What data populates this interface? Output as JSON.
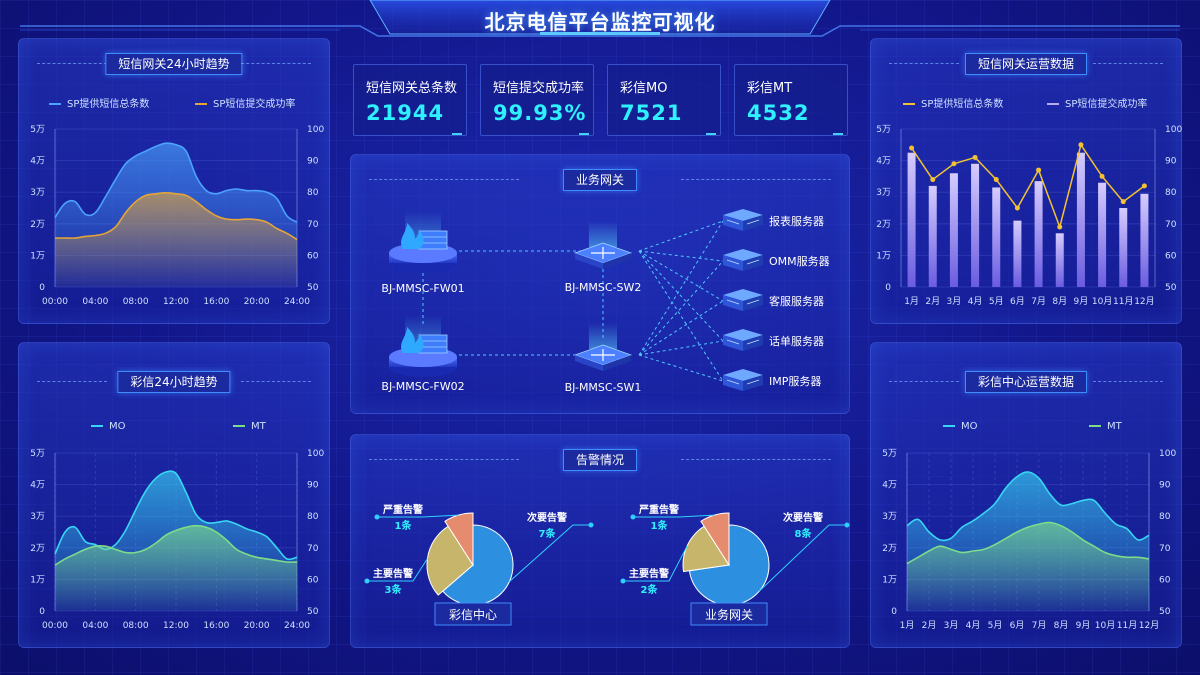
{
  "page": {
    "title": "北京电信平台监控可视化"
  },
  "colors": {
    "bg": "#10127a",
    "cyan": "#2ff0ff",
    "accent_blue": "#3f8cff",
    "sp_total": "#4ba3ff",
    "sp_rate": "#e3a53a",
    "mo": "#38d6f5",
    "mt": "#7ddc8a",
    "gold_line": "#f2c233",
    "bar_purple": "#b7a8f2",
    "pie_minor": "#2d8fe0",
    "pie_major": "#c6b56a",
    "pie_severe": "#e58b6e"
  },
  "kpis": [
    {
      "label": "短信网关总条数",
      "value": "21944"
    },
    {
      "label": "短信提交成功率",
      "value": "99.93%"
    },
    {
      "label": "彩信MO",
      "value": "7521"
    },
    {
      "label": "彩信MT",
      "value": "4532"
    }
  ],
  "panels": {
    "sms_trend": {
      "title": "短信网关24小时趋势",
      "legend": [
        "SP提供短信总条数",
        "SP短信提交成功率"
      ]
    },
    "mms_trend": {
      "title": "彩信24小时趋势",
      "legend": [
        "MO",
        "MT"
      ]
    },
    "sms_ops": {
      "title": "短信网关运营数据",
      "legend": [
        "SP提供短信总条数",
        "SP短信提交成功率"
      ]
    },
    "mms_ops": {
      "title": "彩信中心运营数据",
      "legend": [
        "MO",
        "MT"
      ]
    },
    "gateway": {
      "title": "业务网关",
      "nodes": {
        "fw01": "BJ-MMSC-FW01",
        "fw02": "BJ-MMSC-FW02",
        "sw2": "BJ-MMSC-SW2",
        "sw1": "BJ-MMSC-SW1"
      },
      "servers": [
        "报表服务器",
        "OMM服务器",
        "客服服务器",
        "话单服务器",
        "IMP服务器"
      ],
      "icons": {
        "firewall": "firewall-icon",
        "switch": "switch-icon",
        "server": "server-icon"
      }
    },
    "alarms": {
      "title": "告警情况",
      "pies": [
        {
          "name": "彩信中心",
          "slices": [
            {
              "label": "次要告警",
              "count": "7条",
              "value": 7
            },
            {
              "label": "主要告警",
              "count": "3条",
              "value": 3
            },
            {
              "label": "严重告警",
              "count": "1条",
              "value": 1
            }
          ]
        },
        {
          "name": "业务网关",
          "slices": [
            {
              "label": "次要告警",
              "count": "8条",
              "value": 8
            },
            {
              "label": "主要告警",
              "count": "2条",
              "value": 2
            },
            {
              "label": "严重告警",
              "count": "1条",
              "value": 1
            }
          ]
        }
      ]
    }
  },
  "chart_data": [
    {
      "id": "sms_trend",
      "type": "area",
      "x": [
        "00:00",
        "04:00",
        "08:00",
        "12:00",
        "16:00",
        "20:00",
        "24:00"
      ],
      "y_left_ticks": [
        "0",
        "1万",
        "2万",
        "3万",
        "4万",
        "5万"
      ],
      "y_right_ticks": [
        "50",
        "60",
        "70",
        "80",
        "90",
        "100"
      ],
      "ylim_left": [
        0,
        50000
      ],
      "ylim_right": [
        50,
        100
      ],
      "series": [
        {
          "name": "SP提供短信总条数",
          "axis": "left",
          "x": [
            0,
            1,
            2,
            3,
            4,
            5,
            6,
            7,
            8,
            9,
            10,
            11,
            12,
            13,
            14,
            15,
            16,
            17,
            18,
            19,
            20,
            21,
            22,
            23,
            24
          ],
          "values": [
            22000,
            26500,
            27000,
            23000,
            23500,
            28500,
            34000,
            39000,
            41500,
            43000,
            44500,
            45500,
            45000,
            43000,
            35000,
            30500,
            29500,
            30500,
            31000,
            30500,
            30500,
            30000,
            28000,
            22500,
            20500
          ]
        },
        {
          "name": "SP短信提交成功率",
          "axis": "right",
          "x": [
            0,
            1,
            2,
            3,
            4,
            5,
            6,
            7,
            8,
            9,
            10,
            11,
            12,
            13,
            14,
            15,
            16,
            17,
            18,
            19,
            20,
            21,
            22,
            23,
            24
          ],
          "values": [
            65.5,
            65.5,
            65.5,
            66,
            66.3,
            67,
            69,
            73.5,
            77,
            79,
            79.5,
            79.8,
            79.5,
            79,
            77,
            74.5,
            72.5,
            71.5,
            71.3,
            71.5,
            71.3,
            70.5,
            68.5,
            67,
            65
          ]
        }
      ]
    },
    {
      "id": "mms_trend",
      "type": "area",
      "x": [
        "00:00",
        "04:00",
        "08:00",
        "12:00",
        "16:00",
        "20:00",
        "24:00"
      ],
      "y_left_ticks": [
        "0",
        "1万",
        "2万",
        "3万",
        "4万",
        "5万"
      ],
      "y_right_ticks": [
        "50",
        "60",
        "70",
        "80",
        "90",
        "100"
      ],
      "ylim_left": [
        0,
        50000
      ],
      "ylim_right": [
        50,
        100
      ],
      "series": [
        {
          "name": "MO",
          "axis": "left",
          "x": [
            0,
            1,
            2,
            3,
            4,
            5,
            6,
            7,
            8,
            9,
            10,
            11,
            12,
            13,
            14,
            15,
            16,
            17,
            18,
            19,
            20,
            21,
            22,
            23,
            24
          ],
          "values": [
            18000,
            25000,
            26500,
            22000,
            21000,
            19500,
            21000,
            25500,
            32000,
            38000,
            42000,
            44000,
            43500,
            37500,
            30500,
            28000,
            28000,
            28500,
            27500,
            26000,
            25000,
            23500,
            20000,
            16500,
            17000
          ]
        },
        {
          "name": "MT",
          "axis": "right",
          "x": [
            0,
            1,
            2,
            3,
            4,
            5,
            6,
            7,
            8,
            9,
            10,
            11,
            12,
            13,
            14,
            15,
            16,
            17,
            18,
            19,
            20,
            21,
            22,
            23,
            24
          ],
          "values": [
            64.5,
            66.5,
            68,
            69.5,
            70.5,
            70.5,
            69.5,
            68.5,
            68.5,
            69.5,
            71.5,
            74,
            75.5,
            76.5,
            77,
            76.5,
            75,
            72.5,
            69.5,
            68,
            67,
            66.5,
            66,
            65.5,
            65.5
          ]
        }
      ]
    },
    {
      "id": "sms_ops",
      "type": "bar",
      "categories": [
        "1月",
        "2月",
        "3月",
        "4月",
        "5月",
        "6月",
        "7月",
        "8月",
        "9月",
        "10月",
        "11月",
        "12月"
      ],
      "y_left_ticks": [
        "0",
        "1万",
        "2万",
        "3万",
        "4万",
        "5万"
      ],
      "y_right_ticks": [
        "50",
        "60",
        "70",
        "80",
        "90",
        "100"
      ],
      "ylim_left": [
        0,
        50000
      ],
      "ylim_right": [
        50,
        100
      ],
      "series": [
        {
          "name": "SP提供短信总条数",
          "axis": "right",
          "type": "line",
          "values": [
            94,
            84,
            89,
            91,
            84,
            75,
            87,
            69,
            95,
            85,
            77,
            82
          ]
        },
        {
          "name": "SP短信提交成功率",
          "axis": "left",
          "type": "bar",
          "values": [
            42500,
            32000,
            36000,
            39000,
            31500,
            21000,
            33500,
            17000,
            42500,
            33000,
            25000,
            29500
          ]
        }
      ]
    },
    {
      "id": "mms_ops",
      "type": "area",
      "x": [
        "1月",
        "2月",
        "3月",
        "4月",
        "5月",
        "6月",
        "7月",
        "8月",
        "9月",
        "10月",
        "11月",
        "12月"
      ],
      "y_left_ticks": [
        "0",
        "1万",
        "2万",
        "3万",
        "4万",
        "5万"
      ],
      "y_right_ticks": [
        "50",
        "60",
        "70",
        "80",
        "90",
        "100"
      ],
      "ylim_left": [
        0,
        50000
      ],
      "ylim_right": [
        50,
        100
      ],
      "series": [
        {
          "name": "MO",
          "axis": "left",
          "x": [
            1,
            1.5,
            2,
            2.5,
            3,
            3.5,
            4,
            4.5,
            5,
            5.5,
            6,
            6.5,
            7,
            7.5,
            8,
            8.5,
            9,
            9.5,
            10,
            10.5,
            11,
            11.5,
            12
          ],
          "values": [
            27000,
            29000,
            25000,
            22500,
            23000,
            26500,
            28500,
            31000,
            34000,
            39000,
            42500,
            44000,
            42000,
            37000,
            33500,
            34000,
            35000,
            35000,
            31000,
            27500,
            26000,
            22500,
            24000
          ]
        },
        {
          "name": "MT",
          "axis": "right",
          "x": [
            1,
            1.5,
            2,
            2.5,
            3,
            3.5,
            4,
            4.5,
            5,
            5.5,
            6,
            6.5,
            7,
            7.5,
            8,
            8.5,
            9,
            9.5,
            10,
            10.5,
            11,
            11.5,
            12
          ],
          "values": [
            65,
            67,
            69,
            70.5,
            69.5,
            68.5,
            69,
            69.5,
            71,
            73,
            75,
            76.5,
            77.5,
            78,
            77,
            75,
            72.5,
            70.5,
            68.5,
            67.5,
            67,
            67,
            66.5
          ]
        }
      ]
    },
    {
      "id": "alarms_mms_center",
      "type": "pie",
      "title": "彩信中心",
      "categories": [
        "次要告警",
        "主要告警",
        "严重告警"
      ],
      "values": [
        7,
        3,
        1
      ]
    },
    {
      "id": "alarms_gateway",
      "type": "pie",
      "title": "业务网关",
      "categories": [
        "次要告警",
        "主要告警",
        "严重告警"
      ],
      "values": [
        8,
        2,
        1
      ]
    }
  ]
}
